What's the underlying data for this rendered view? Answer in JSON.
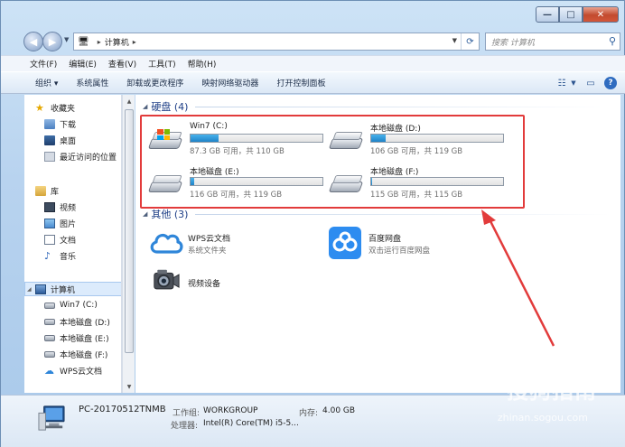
{
  "window": {
    "controls": {
      "minimize": "—",
      "maximize": "□",
      "close": "✕"
    }
  },
  "address": {
    "crumbs": [
      "计算机"
    ],
    "search_placeholder": "搜索 计算机"
  },
  "menu": [
    "文件(F)",
    "编辑(E)",
    "查看(V)",
    "工具(T)",
    "帮助(H)"
  ],
  "toolbar": {
    "organize": "组织 ▾",
    "system_properties": "系统属性",
    "uninstall": "卸载或更改程序",
    "map_drive": "映射网络驱动器",
    "control_panel": "打开控制面板"
  },
  "nav_pane": {
    "favorites": "收藏夹",
    "downloads": "下载",
    "desktop": "桌面",
    "recent": "最近访问的位置",
    "libraries": "库",
    "videos": "视频",
    "pictures": "图片",
    "documents": "文档",
    "music": "音乐",
    "computer": "计算机",
    "drive_c": "Win7 (C:)",
    "drive_d": "本地磁盘 (D:)",
    "drive_e": "本地磁盘 (E:)",
    "drive_f": "本地磁盘 (F:)",
    "wps": "WPS云文档"
  },
  "groups": {
    "hard_disks": "硬盘 (4)",
    "others": "其他 (3)"
  },
  "drives": [
    {
      "name": "Win7 (C:)",
      "free": "87.3 GB 可用，共 110 GB",
      "used_fraction": 0.21
    },
    {
      "name": "本地磁盘 (D:)",
      "free": "106 GB 可用，共 119 GB",
      "used_fraction": 0.11
    },
    {
      "name": "本地磁盘 (E:)",
      "free": "116 GB 可用，共 119 GB",
      "used_fraction": 0.025
    },
    {
      "name": "本地磁盘 (F:)",
      "free": "115 GB 可用，共 115 GB",
      "used_fraction": 0.005
    }
  ],
  "others": [
    {
      "name": "WPS云文档",
      "desc": "系统文件夹"
    },
    {
      "name": "百度网盘",
      "desc": "双击运行百度网盘"
    },
    {
      "name": "视频设备",
      "desc": ""
    }
  ],
  "details": {
    "pc_name": "PC-20170512TNMB",
    "workgroup_label": "工作组:",
    "workgroup_value": "WORKGROUP",
    "memory_label": "内存:",
    "memory_value": "4.00 GB",
    "cpu_label": "处理器:",
    "cpu_value": "Intel(R) Core(TM) i5-5..."
  },
  "watermark": {
    "text": "搜狗指南",
    "url": "zhinan.sogou.com"
  },
  "colors": {
    "highlight": "#e23b3b",
    "bar_fill": "#1f83c8",
    "group_header": "#1e3f87"
  }
}
